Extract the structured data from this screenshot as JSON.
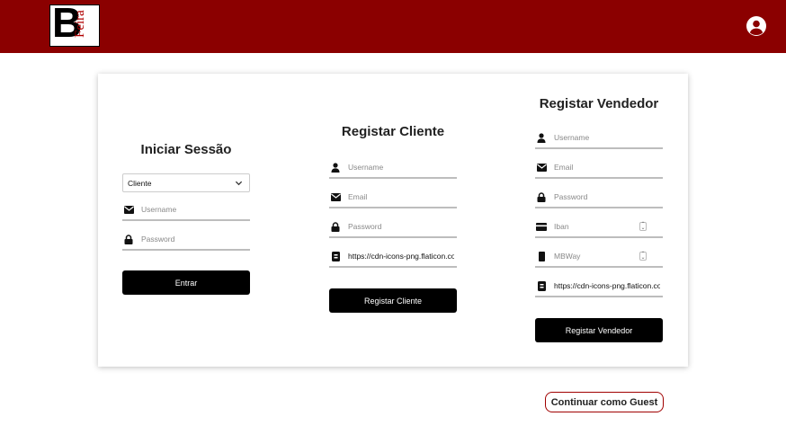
{
  "header": {
    "logo_letter": "B",
    "logo_word": "Feira",
    "user_icon": "user-circle-icon",
    "bg_color": "#8b0000"
  },
  "login": {
    "title": "Iniciar Sessão",
    "type_select": "Cliente",
    "username_placeholder": "Username",
    "password_placeholder": "Password",
    "submit_label": "Entrar"
  },
  "register_client": {
    "title": "Registar Cliente",
    "username_placeholder": "Username",
    "email_placeholder": "Email",
    "password_placeholder": "Password",
    "image_url": "https://cdn-icons-png.flaticon.com",
    "submit_label": "Registar Cliente"
  },
  "register_seller": {
    "title": "Registar Vendedor",
    "username_placeholder": "Username",
    "email_placeholder": "Email",
    "password_placeholder": "Password",
    "iban_placeholder": "Iban",
    "mbway_placeholder": "MBWay",
    "image_url": "https://cdn-icons-png.flaticon.com",
    "submit_label": "Registar Vendedor"
  },
  "guest_button_label": "Continuar como Guest"
}
